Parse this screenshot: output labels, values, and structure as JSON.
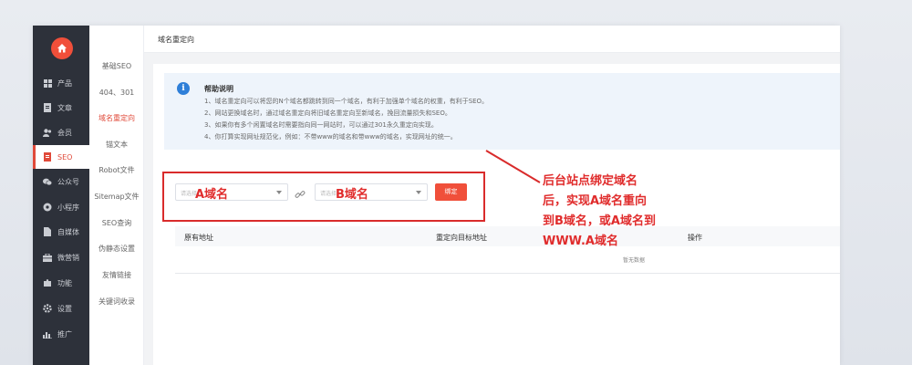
{
  "main_nav": {
    "items": [
      {
        "label": "产品",
        "icon": "grid-icon"
      },
      {
        "label": "文章",
        "icon": "document-icon"
      },
      {
        "label": "会员",
        "icon": "users-icon"
      },
      {
        "label": "SEO",
        "icon": "seo-file-icon"
      },
      {
        "label": "公众号",
        "icon": "wechat-icon"
      },
      {
        "label": "小程序",
        "icon": "mini-program-icon"
      },
      {
        "label": "自媒体",
        "icon": "media-file-icon"
      },
      {
        "label": "微营销",
        "icon": "marketing-icon"
      },
      {
        "label": "功能",
        "icon": "puzzle-icon"
      },
      {
        "label": "设置",
        "icon": "gear-icon"
      },
      {
        "label": "推广",
        "icon": "chart-icon"
      }
    ]
  },
  "sub_nav": {
    "items": [
      "基础SEO",
      "404、301",
      "域名重定向",
      "锚文本",
      "Robot文件",
      "Sitemap文件",
      "SEO查询",
      "伪静态设置",
      "友情链接",
      "关键词收录"
    ]
  },
  "header": {
    "title": "域名重定向"
  },
  "help": {
    "title": "帮助说明",
    "lines": [
      "1、域名重定向可以将您的N个域名都跳转到同一个域名，有利于加强单个域名的权重，有利于SEO。",
      "2、网站更换域名时，通过域名重定向将旧域名重定向至新域名，挽回流量损失和SEO。",
      "3、如果你有多个闲置域名时需要指向同一网站时，可以通过301永久重定向实现。",
      "4、你打算实现网址规范化，例如：不带www的域名和带www的域名，实现网址的统一。"
    ]
  },
  "form": {
    "source_placeholder": "请选择",
    "target_placeholder": "请选择",
    "source_label": "A域名",
    "target_label": "B域名",
    "bind_label": "绑定"
  },
  "table": {
    "columns": [
      "原有地址",
      "重定向目标地址",
      "操作"
    ],
    "empty_text": "暂无数据"
  },
  "annotation": {
    "lines": [
      "后台站点绑定域名",
      "后，实现A域名重向",
      "到B域名，或A域名到",
      "WWW.A域名"
    ]
  },
  "colors": {
    "accent": "#f04f3a",
    "annotation": "#e02c2c",
    "nav_bg": "#2d313a",
    "info": "#2f7fd8"
  }
}
